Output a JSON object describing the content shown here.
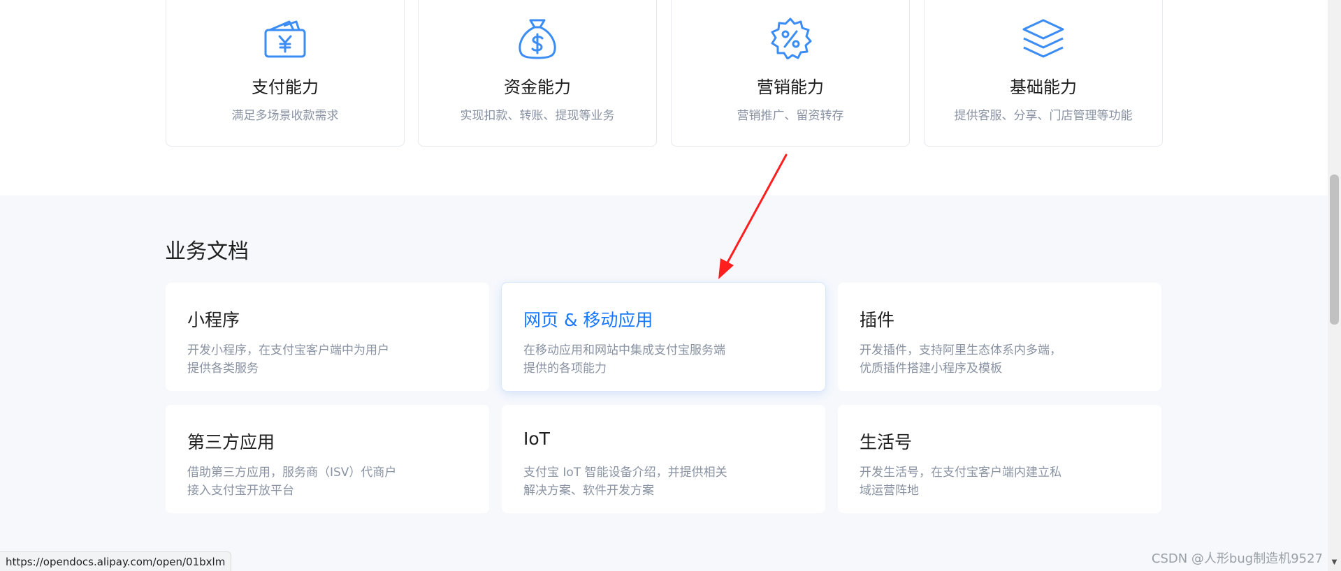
{
  "capabilities": [
    {
      "icon": "wallet-yuan-icon",
      "title": "支付能力",
      "desc": "满足多场景收款需求"
    },
    {
      "icon": "money-bag-dollar-icon",
      "title": "资金能力",
      "desc": "实现扣款、转账、提现等业务"
    },
    {
      "icon": "percent-badge-icon",
      "title": "营销能力",
      "desc": "营销推广、留资转存"
    },
    {
      "icon": "layers-icon",
      "title": "基础能力",
      "desc": "提供客服、分享、门店管理等功能"
    }
  ],
  "docs_section": {
    "title": "业务文档",
    "cards": [
      {
        "title": "小程序",
        "desc": "开发小程序，在支付宝客户端中为用户提供各类服务"
      },
      {
        "title": "网页 & 移动应用",
        "desc": "在移动应用和网站中集成支付宝服务端提供的各项能力"
      },
      {
        "title": "插件",
        "desc": "开发插件，支持阿里生态体系内多端，优质插件搭建小程序及模板"
      },
      {
        "title": "第三方应用",
        "desc": "借助第三方应用，服务商（ISV）代商户接入支付宝开放平台"
      },
      {
        "title": "IoT",
        "desc": "支付宝 IoT 智能设备介绍，并提供相关解决方案、软件开发方案"
      },
      {
        "title": "生活号",
        "desc": "开发生活号，在支付宝客户端内建立私域运营阵地"
      }
    ]
  },
  "status_bar": {
    "url": "https://opendocs.alipay.com/open/01bxlm"
  },
  "watermark": "CSDN @人形bug制造机9527",
  "colors": {
    "accent": "#1677ff",
    "icon": "#3b8cf5",
    "annotation": "#ff1f1f",
    "section_bg": "#f6f8fc"
  }
}
